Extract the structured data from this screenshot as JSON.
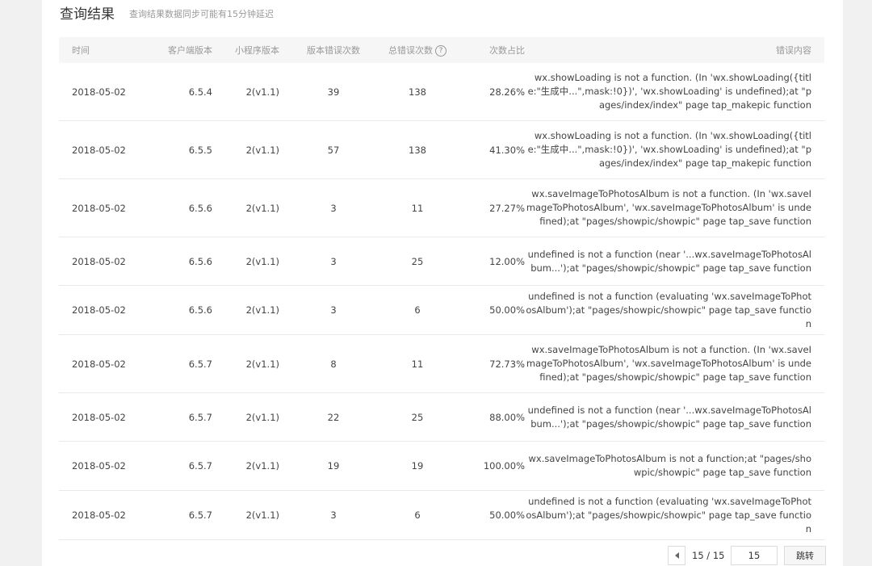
{
  "header": {
    "title": "查询结果",
    "subtitle": "查询结果数据同步可能有15分钟延迟"
  },
  "table": {
    "columns": {
      "time": "时间",
      "client_version": "客户端版本",
      "mini_version": "小程序版本",
      "version_errors": "版本错误次数",
      "total_errors": "总错误次数",
      "ratio": "次数占比",
      "message": "错误内容"
    },
    "rows": [
      {
        "time": "2018-05-02",
        "client_version": "6.5.4",
        "mini_version": "2(v1.1)",
        "version_errors": "39",
        "total_errors": "138",
        "ratio": "28.26%",
        "message": "wx.showLoading is not a function. (In 'wx.showLoading({title:\"生成中...\",mask:!0})', 'wx.showLoading' is undefined);at \"pages/index/index\" page tap_makepic function"
      },
      {
        "time": "2018-05-02",
        "client_version": "6.5.5",
        "mini_version": "2(v1.1)",
        "version_errors": "57",
        "total_errors": "138",
        "ratio": "41.30%",
        "message": "wx.showLoading is not a function. (In 'wx.showLoading({title:\"生成中...\",mask:!0})', 'wx.showLoading' is undefined);at \"pages/index/index\" page tap_makepic function"
      },
      {
        "time": "2018-05-02",
        "client_version": "6.5.6",
        "mini_version": "2(v1.1)",
        "version_errors": "3",
        "total_errors": "11",
        "ratio": "27.27%",
        "message": "wx.saveImageToPhotosAlbum is not a function. (In 'wx.saveImageToPhotosAlbum', 'wx.saveImageToPhotosAlbum' is undefined);at \"pages/showpic/showpic\" page tap_save function"
      },
      {
        "time": "2018-05-02",
        "client_version": "6.5.6",
        "mini_version": "2(v1.1)",
        "version_errors": "3",
        "total_errors": "25",
        "ratio": "12.00%",
        "message": "undefined is not a function (near '...wx.saveImageToPhotosAlbum...');at \"pages/showpic/showpic\" page tap_save function"
      },
      {
        "time": "2018-05-02",
        "client_version": "6.5.6",
        "mini_version": "2(v1.1)",
        "version_errors": "3",
        "total_errors": "6",
        "ratio": "50.00%",
        "message": "undefined is not a function (evaluating 'wx.saveImageToPhotosAlbum');at \"pages/showpic/showpic\" page tap_save function"
      },
      {
        "time": "2018-05-02",
        "client_version": "6.5.7",
        "mini_version": "2(v1.1)",
        "version_errors": "8",
        "total_errors": "11",
        "ratio": "72.73%",
        "message": "wx.saveImageToPhotosAlbum is not a function. (In 'wx.saveImageToPhotosAlbum', 'wx.saveImageToPhotosAlbum' is undefined);at \"pages/showpic/showpic\" page tap_save function"
      },
      {
        "time": "2018-05-02",
        "client_version": "6.5.7",
        "mini_version": "2(v1.1)",
        "version_errors": "22",
        "total_errors": "25",
        "ratio": "88.00%",
        "message": "undefined is not a function (near '...wx.saveImageToPhotosAlbum...');at \"pages/showpic/showpic\" page tap_save function"
      },
      {
        "time": "2018-05-02",
        "client_version": "6.5.7",
        "mini_version": "2(v1.1)",
        "version_errors": "19",
        "total_errors": "19",
        "ratio": "100.00%",
        "message": "wx.saveImageToPhotosAlbum is not a function;at \"pages/showpic/showpic\" page tap_save function"
      },
      {
        "time": "2018-05-02",
        "client_version": "6.5.7",
        "mini_version": "2(v1.1)",
        "version_errors": "3",
        "total_errors": "6",
        "ratio": "50.00%",
        "message": "undefined is not a function (evaluating 'wx.saveImageToPhotosAlbum');at \"pages/showpic/showpic\" page tap_save function"
      }
    ]
  },
  "pagination": {
    "count": "15 / 15",
    "input_value": "15",
    "jump_label": "跳转"
  },
  "icons": {
    "help": "question-circle-icon",
    "prev": "triangle-left-icon"
  }
}
